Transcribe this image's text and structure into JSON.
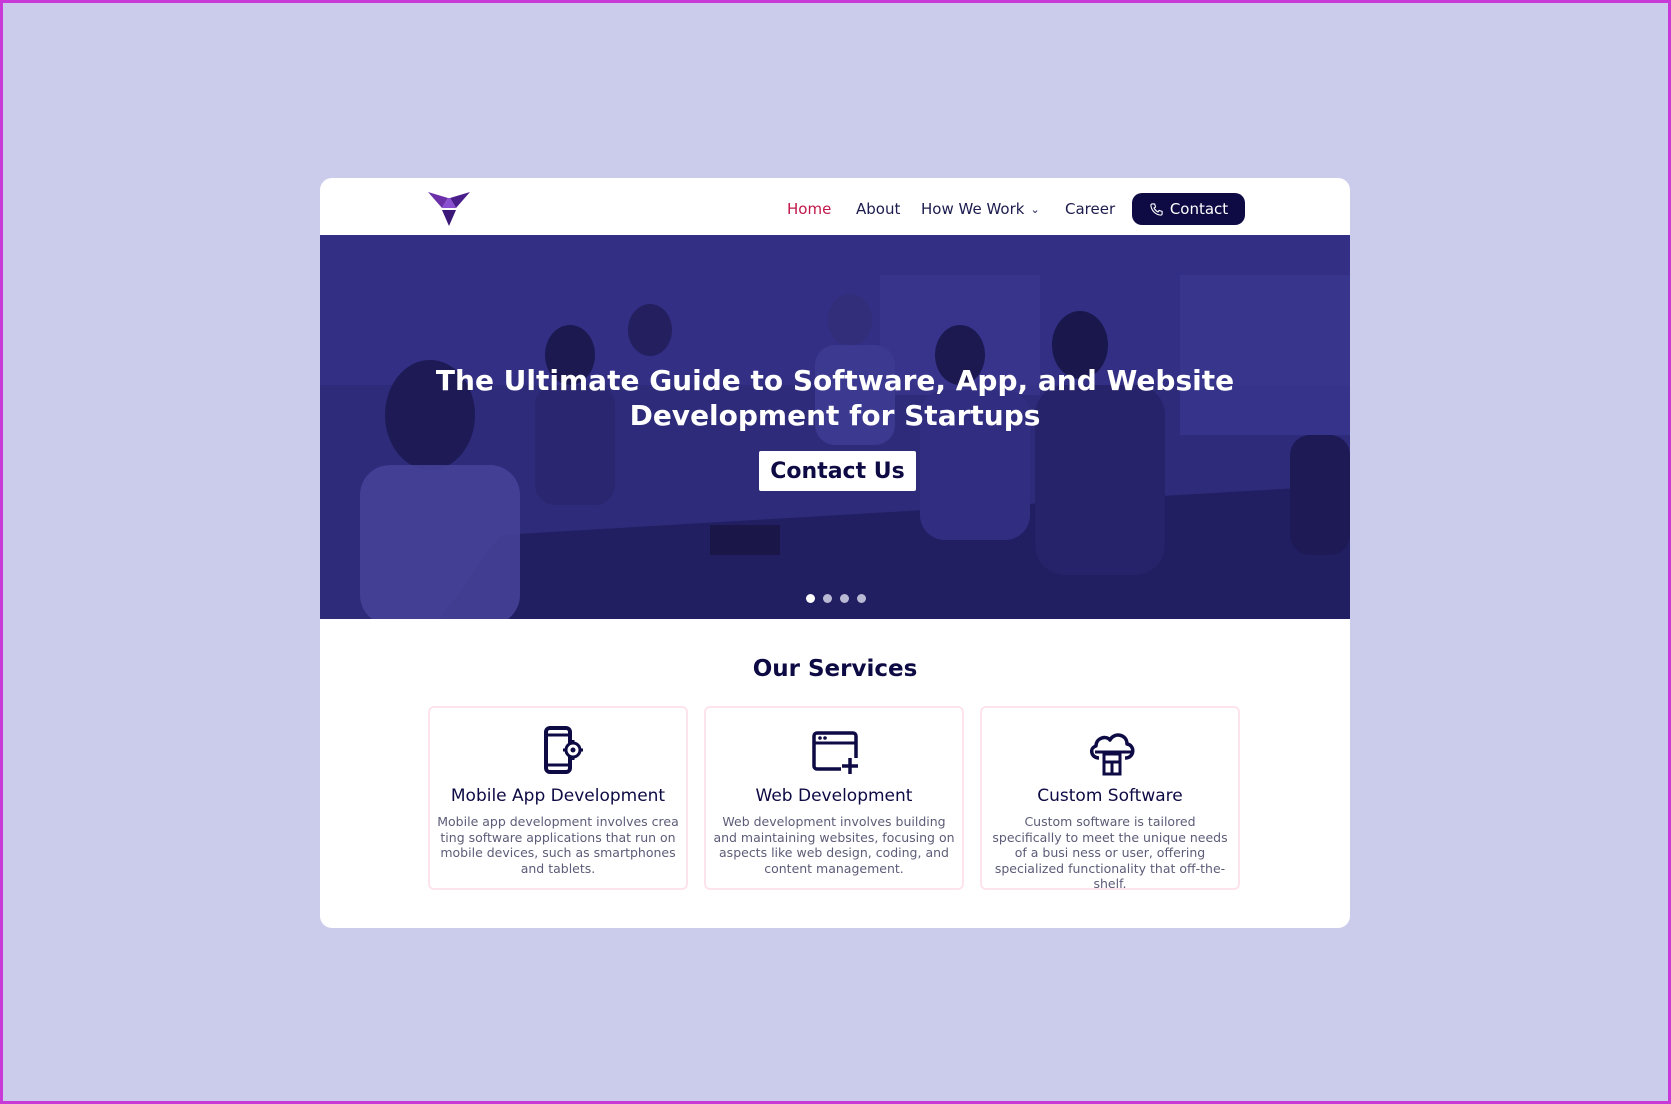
{
  "nav": {
    "items": [
      "Home",
      "About",
      "How We Work",
      "Career"
    ],
    "contact_label": "Contact"
  },
  "hero": {
    "title": "The Ultimate Guide to Software, App, and Website Development for Startups",
    "cta": "Contact Us",
    "slide_count": 4,
    "active_slide": 1
  },
  "services": {
    "heading": "Our Services",
    "items": [
      {
        "title": "Mobile App Development",
        "description": "Mobile app development involves crea ting software applications that run on mobile devices, such as smartphones and tablets."
      },
      {
        "title": "Web Development",
        "description": "Web development involves building and maintaining websites, focusing on aspects like web design, coding, and content management."
      },
      {
        "title": "Custom Software",
        "description": "Custom software is tailored specifically to meet the unique needs of a busi ness or user, offering specialized functionality that off-the-shelf."
      }
    ]
  },
  "colors": {
    "page_bg": "#cbcbeb",
    "frame_border": "#c83ad8",
    "accent_navy": "#0d0a44",
    "active_nav": "#c0174a",
    "card_border": "#fde4ec"
  }
}
